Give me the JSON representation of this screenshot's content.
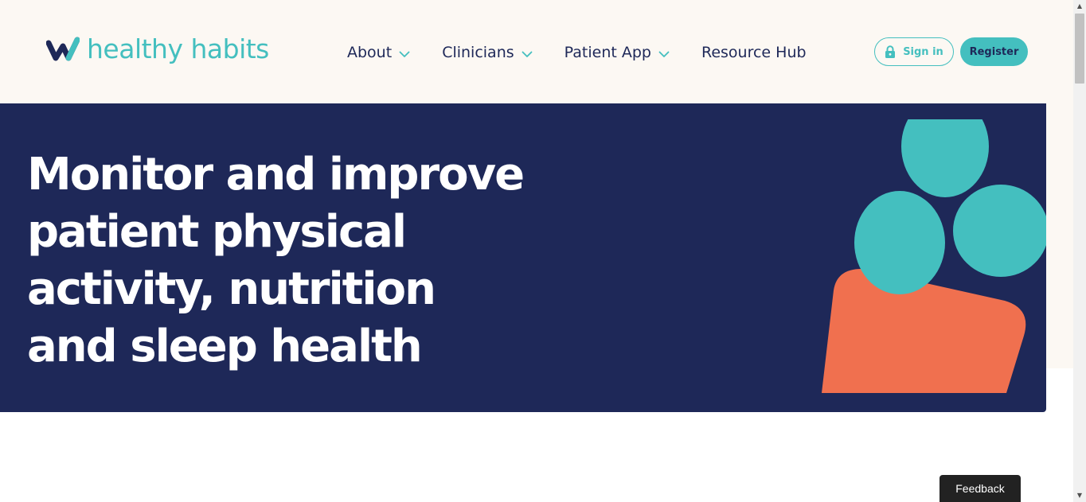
{
  "colors": {
    "brand_teal": "#44bfbf",
    "navy": "#1e2858",
    "coral": "#f0704f",
    "header_bg": "#fcf8f3"
  },
  "header": {
    "logo": {
      "text": "healthy habits",
      "icon": "healthy-habits-logo-icon"
    },
    "nav": [
      {
        "label": "About",
        "has_dropdown": true,
        "icon": "chevron-down-icon"
      },
      {
        "label": "Clinicians",
        "has_dropdown": true,
        "icon": "chevron-down-icon"
      },
      {
        "label": "Patient App",
        "has_dropdown": true,
        "icon": "chevron-down-icon"
      },
      {
        "label": "Resource Hub",
        "has_dropdown": false
      }
    ],
    "sign_in": {
      "label": "Sign in",
      "icon": "lock-icon"
    },
    "register": {
      "label": "Register"
    }
  },
  "hero": {
    "title": "Monitor and improve patient physical activity, nutrition and sleep health",
    "illustration": "abstract-person-group-illustration"
  },
  "feedback": {
    "label": "Feedback"
  }
}
